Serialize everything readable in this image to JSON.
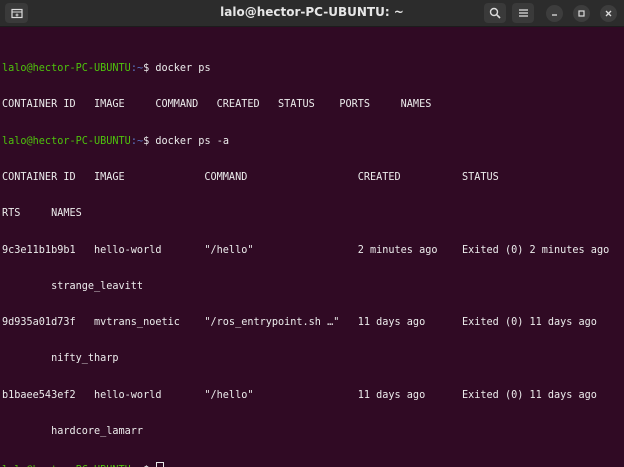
{
  "window": {
    "title": "lalo@hector-PC-UBUNTU: ~"
  },
  "icons": {
    "new_tab": "new-tab-icon",
    "search": "search-icon",
    "menu": "hamburger-menu-icon",
    "minimize": "minimize-icon",
    "maximize": "maximize-icon",
    "close": "close-icon"
  },
  "terminal": {
    "prompt_user": "lalo@hector-PC-UBUNTU",
    "prompt_path": ":~",
    "prompt_symbol": "$ ",
    "lines": [
      {
        "kind": "prompt",
        "command": "docker ps"
      },
      {
        "kind": "output",
        "text": "CONTAINER ID   IMAGE     COMMAND   CREATED   STATUS    PORTS     NAMES"
      },
      {
        "kind": "prompt",
        "command": "docker ps -a"
      },
      {
        "kind": "output",
        "text": "CONTAINER ID   IMAGE             COMMAND                  CREATED          STATUS                      PO"
      },
      {
        "kind": "output",
        "text": "RTS     NAMES"
      },
      {
        "kind": "output",
        "text": "9c3e11b1b9b1   hello-world       \"/hello\"                 2 minutes ago    Exited (0) 2 minutes ago"
      },
      {
        "kind": "output",
        "text": "        strange_leavitt"
      },
      {
        "kind": "output",
        "text": "9d935a01d73f   mvtrans_noetic    \"/ros_entrypoint.sh …\"   11 days ago      Exited (0) 11 days ago"
      },
      {
        "kind": "output",
        "text": "        nifty_tharp"
      },
      {
        "kind": "output",
        "text": "b1baee543ef2   hello-world       \"/hello\"                 11 days ago      Exited (0) 11 days ago"
      },
      {
        "kind": "output",
        "text": "        hardcore_lamarr"
      },
      {
        "kind": "prompt",
        "command": ""
      }
    ]
  },
  "colors": {
    "background": "#300a24",
    "prompt_user": "#4ec20c",
    "prompt_path": "#5a78c8",
    "text": "#ececec"
  }
}
